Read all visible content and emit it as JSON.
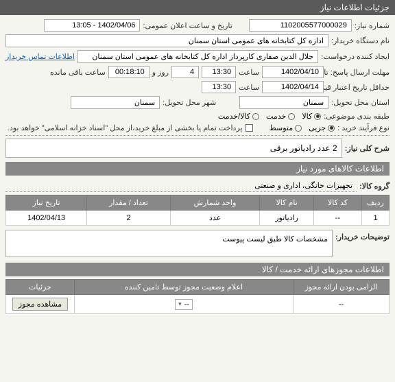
{
  "header": {
    "title": "جزئیات اطلاعات نیاز"
  },
  "form": {
    "need_number_label": "شماره نیاز:",
    "need_number": "1102005577000029",
    "announce_label": "تاریخ و ساعت اعلان عمومی:",
    "announce_value": "1402/04/06 - 13:05",
    "buyer_org_label": "نام دستگاه خریدار:",
    "buyer_org": "اداره کل کتابخانه های عمومی استان سمنان",
    "requester_label": "ایجاد کننده درخواست:",
    "requester": "جلال الدین صفاری کارپرداز اداره کل کتابخانه های عمومی استان سمنان",
    "contact_link": "اطلاعات تماس خریدار",
    "deadline1_label": "مهلت ارسال پاسخ: تا تاریخ:",
    "deadline1_date": "1402/04/10",
    "time_label": "ساعت",
    "deadline1_time": "13:30",
    "day_label": "روز و",
    "days_remaining": "4",
    "remaining_label": "ساعت باقی مانده",
    "remaining_value": "00:18:10",
    "deadline2_label": "حداقل تاریخ اعتبار قیمت: تا تاریخ:",
    "deadline2_date": "1402/04/14",
    "deadline2_time": "13:30",
    "province_label": "استان محل تحویل:",
    "province": "سمنان",
    "city_label": "شهر محل تحویل:",
    "city": "سمنان",
    "category_label": "طبقه بندی موضوعی:",
    "cat_goods": "کالا",
    "cat_service": "خدمت",
    "cat_goods_service": "کالا/خدمت",
    "process_label": "نوع فرآیند خرید :",
    "proc_small": "جزیی",
    "proc_medium": "متوسط",
    "payment_note": "پرداخت تمام یا بخشی از مبلغ خرید،از محل \"اسناد خزانه اسلامی\" خواهد بود."
  },
  "summary": {
    "label": "شرح کلی نیاز:",
    "text": "2 عدد رادیاتور برقی"
  },
  "goods_section": {
    "title": "اطلاعات کالاهای مورد نیاز",
    "group_label": "گروه کالا:",
    "group_value": "تجهیزات خانگی، اداری و صنعتی"
  },
  "table": {
    "headers": [
      "ردیف",
      "کد کالا",
      "نام کالا",
      "واحد شمارش",
      "تعداد / مقدار",
      "تاریخ نیاز"
    ],
    "rows": [
      {
        "idx": "1",
        "code": "--",
        "name": "رادیاتور",
        "unit": "عدد",
        "qty": "2",
        "date": "1402/04/13"
      }
    ]
  },
  "buyer_notes": {
    "label": "توضیحات خریدار:",
    "text": "مشخصات کالا طبق لیست پیوست"
  },
  "license_section": {
    "title": "اطلاعات مجوزهای ارائه خدمت / کالا",
    "headers": [
      "الزامی بودن ارائه مجوز",
      "اعلام وضعیت مجوز توسط تامین کننده",
      "جزئیات"
    ],
    "row": {
      "mandatory": "--",
      "status": "--",
      "detail_btn": "مشاهده مجوز"
    }
  }
}
